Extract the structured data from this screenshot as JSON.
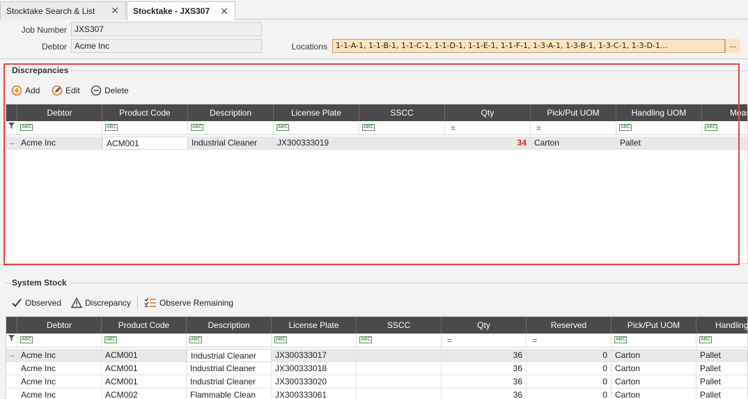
{
  "tabs": [
    {
      "label": "Stocktake Search & List",
      "active": false
    },
    {
      "label": "Stocktake - JXS307",
      "active": true
    }
  ],
  "header": {
    "job_number_label": "Job Number",
    "job_number": "JXS307",
    "debtor_label": "Debtor",
    "debtor": "Acme Inc",
    "locations_label": "Locations",
    "locations": "1-1-A-1, 1-1-B-1, 1-1-C-1, 1-1-D-1, 1-1-E-1, 1-1-F-1, 1-3-A-1, 1-3-B-1, 1-3-C-1, 1-3-D-1...",
    "locations_button": "..."
  },
  "discrepancies": {
    "title": "Discrepancies",
    "toolbar": {
      "add": "Add",
      "edit": "Edit",
      "delete": "Delete"
    },
    "columns": [
      "Debtor",
      "Product Code",
      "Description",
      "License Plate",
      "SSCC",
      "Qty",
      "Pick/Put UOM",
      "Handling UOM",
      "Meas"
    ],
    "rows": [
      [
        "Acme Inc",
        "ACM001",
        "Industrial Cleaner",
        "JX300333019",
        "",
        "34",
        "Carton",
        "Pallet"
      ]
    ]
  },
  "system_stock": {
    "title": "System Stock",
    "toolbar": {
      "observed": "Observed",
      "discrepancy": "Discrepancy",
      "observe_remaining": "Observe Remaining"
    },
    "columns": [
      "Debtor",
      "Product Code",
      "Description",
      "License Plate",
      "SSCC",
      "Qty",
      "Reserved",
      "Pick/Put UOM",
      "Handling U"
    ],
    "rows": [
      [
        "Acme Inc",
        "ACM001",
        "Industrial Cleaner",
        "JX300333017",
        "",
        "36",
        "0",
        "Carton",
        "Pallet"
      ],
      [
        "Acme Inc",
        "ACM001",
        "Industrial Cleaner",
        "JX300333018",
        "",
        "36",
        "0",
        "Carton",
        "Pallet"
      ],
      [
        "Acme Inc",
        "ACM001",
        "Industrial Cleaner",
        "JX300333020",
        "",
        "36",
        "0",
        "Carton",
        "Pallet"
      ],
      [
        "Acme Inc",
        "ACM002",
        "Flammable Clean",
        "JX300333061",
        "",
        "36",
        "0",
        "Carton",
        "Pallet"
      ]
    ]
  },
  "colors": {
    "accent_red": "#e04545",
    "header_bg": "#4a4a4a",
    "location_bg": "#fbe3bf",
    "qty_alert": "#e02020"
  }
}
